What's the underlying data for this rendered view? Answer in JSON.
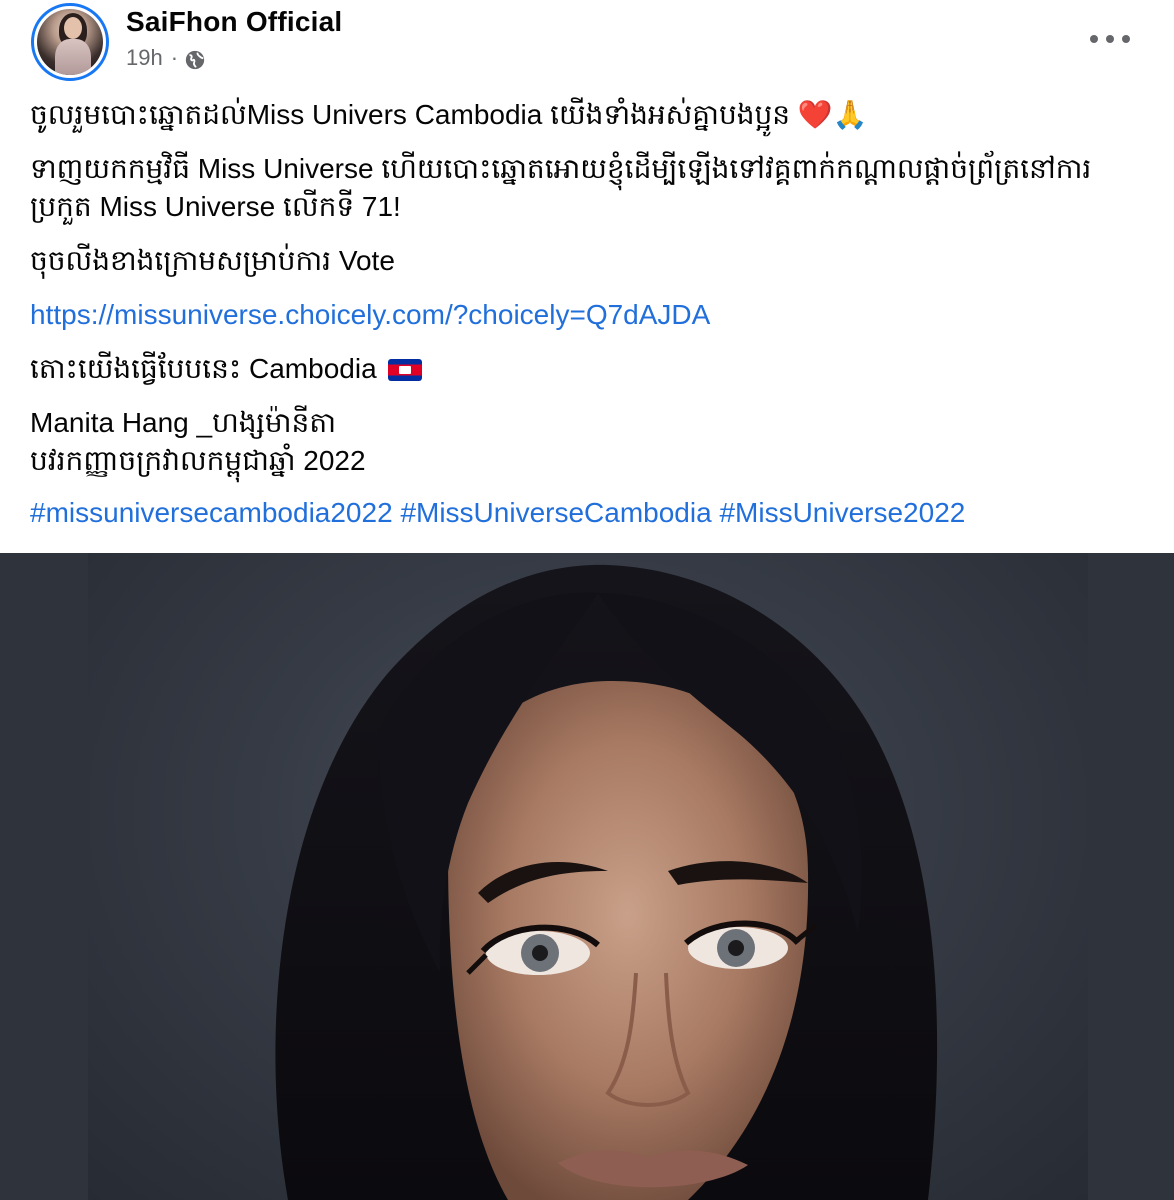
{
  "post": {
    "author": "SaiFhon Official",
    "time": "19h",
    "meta_separator": "·",
    "privacy_icon": "globe-icon",
    "more_icon": "more-horizontal-icon"
  },
  "content": {
    "line1": "ចូលរួមបោះឆ្នោតដល់Miss Univers Cambodia យើងទាំងអស់គ្នាបងប្អូន",
    "line1_emoji": "❤️🙏",
    "line2": "ទាញយកកម្មវិធី Miss Universe ហើយបោះឆ្នោតអោយខ្ញុំដើម្បីឡើងទៅវគ្គពាក់កណ្តាលផ្តាច់ព្រ័ត្រនៅការប្រកួត Miss Universe លើកទី 71!",
    "line3": "ចុចលីងខាងក្រោមសម្រាប់ការ Vote",
    "link": "https://missuniverse.choicely.com/?choicely=Q7dAJDA",
    "line4": "តោះយើងធ្វើបែបនេះ Cambodia",
    "line4_flag": "cambodia-flag",
    "name_line": "Manita Hang _ហង្សម៉ានីតា",
    "title_line": "បវរកញ្ញាចក្រវាលកម្ពុជាឆ្នាំ 2022",
    "hashtags": [
      "#missuniversecambodia2022",
      "#MissUniverseCambodia",
      "#MissUniverse2022"
    ]
  },
  "colors": {
    "link": "#216fdb",
    "name": "#050505",
    "meta": "#65676b",
    "avatar_ring": "#1877f2",
    "photo_bg": "#363b45"
  }
}
